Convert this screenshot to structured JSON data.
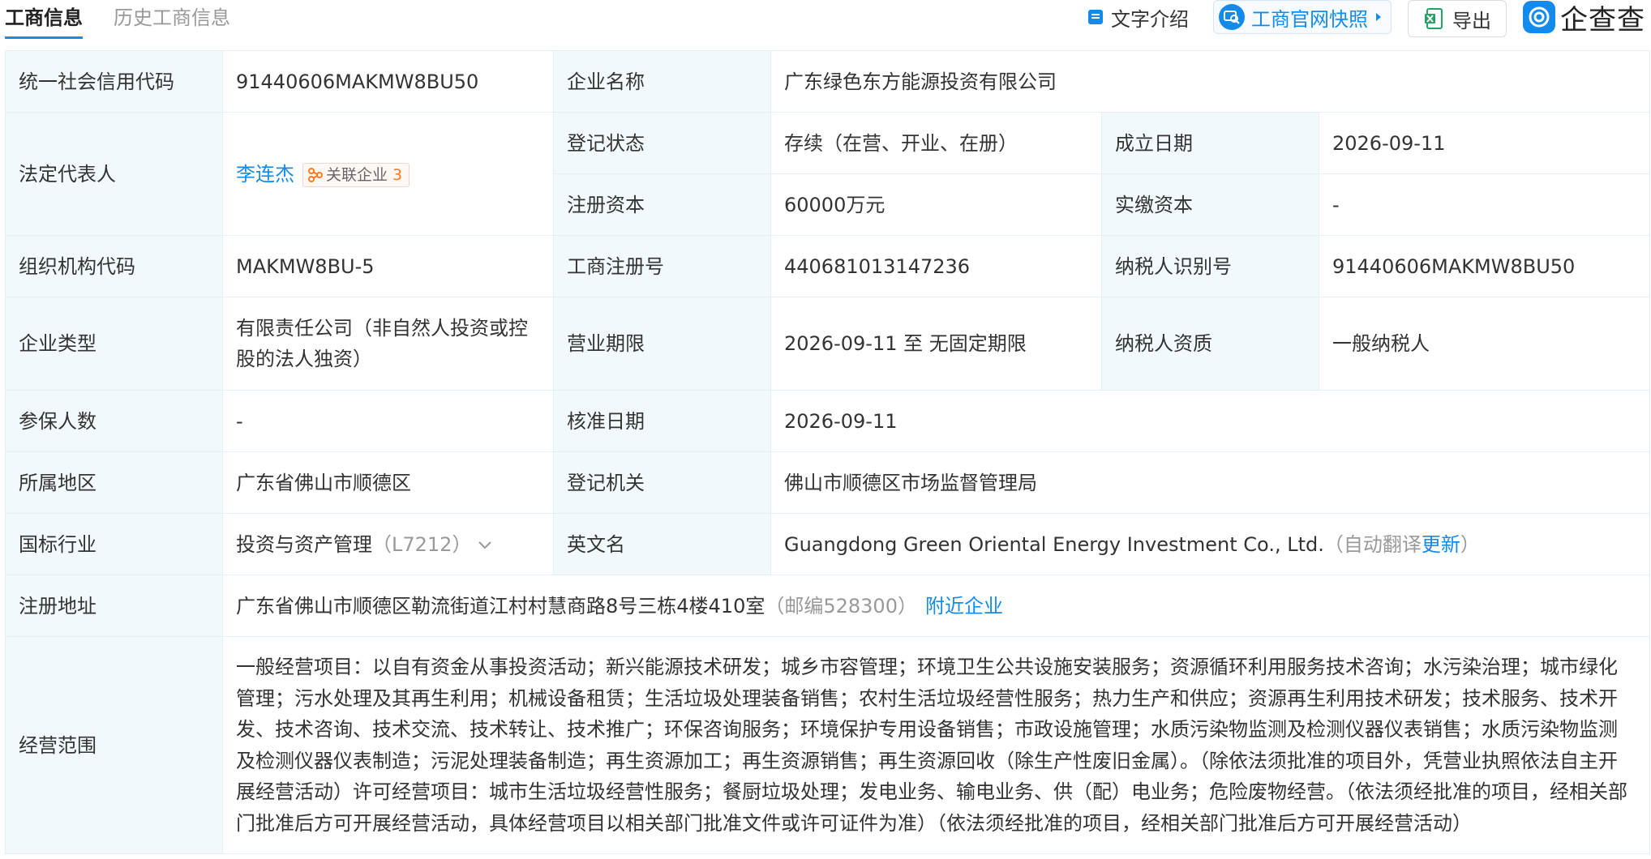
{
  "tabs": {
    "current": "工商信息",
    "history": "历史工商信息"
  },
  "toolbar": {
    "intro_label": "文字介绍",
    "snapshot_label": "工商官网快照",
    "export_label": "导出",
    "logo_text": "企查查"
  },
  "colors": {
    "accent": "#128bed",
    "label_bg": "#f2f9fc",
    "border": "#e4eef6",
    "tag_count": "#fd7b1f"
  },
  "fields": {
    "credit_code": {
      "label": "统一社会信用代码",
      "value": "91440606MAKMW8BU50"
    },
    "company_name": {
      "label": "企业名称",
      "value": "广东绿色东方能源投资有限公司"
    },
    "legal_rep": {
      "label": "法定代表人",
      "name": "李连杰",
      "related_label": "关联企业",
      "related_count": "3"
    },
    "reg_status": {
      "label": "登记状态",
      "value": "存续（在营、开业、在册）"
    },
    "est_date": {
      "label": "成立日期",
      "value": "2026-09-11"
    },
    "reg_capital": {
      "label": "注册资本",
      "value": "60000万元"
    },
    "paid_capital": {
      "label": "实缴资本",
      "value": "-"
    },
    "org_code": {
      "label": "组织机构代码",
      "value": "MAKMW8BU-5"
    },
    "reg_number": {
      "label": "工商注册号",
      "value": "440681013147236"
    },
    "taxpayer_id": {
      "label": "纳税人识别号",
      "value": "91440606MAKMW8BU50"
    },
    "company_type": {
      "label": "企业类型",
      "value": "有限责任公司（非自然人投资或控股的法人独资）"
    },
    "business_term": {
      "label": "营业期限",
      "value": "2026-09-11 至 无固定期限"
    },
    "taxpayer_qual": {
      "label": "纳税人资质",
      "value": "一般纳税人"
    },
    "insured": {
      "label": "参保人数",
      "value": "-"
    },
    "approval_date": {
      "label": "核准日期",
      "value": "2026-09-11"
    },
    "region": {
      "label": "所属地区",
      "value": "广东省佛山市顺德区"
    },
    "authority": {
      "label": "登记机关",
      "value": "佛山市顺德区市场监督管理局"
    },
    "industry": {
      "label": "国标行业",
      "value": "投资与资产管理",
      "code": "（L7212）"
    },
    "english_name": {
      "label": "英文名",
      "value": "Guangdong Green Oriental Energy Investment Co., Ltd.",
      "note_open": "（自动翻译",
      "update_link": "更新",
      "note_close": "）"
    },
    "address": {
      "label": "注册地址",
      "value": "广东省佛山市顺德区勒流街道江村村慧商路8号三栋4楼410室",
      "postcode": "（邮编528300）",
      "nearby_link": "附近企业"
    },
    "scope": {
      "label": "经营范围",
      "value": "一般经营项目：以自有资金从事投资活动；新兴能源技术研发；城乡市容管理；环境卫生公共设施安装服务；资源循环利用服务技术咨询；水污染治理；城市绿化管理；污水处理及其再生利用；机械设备租赁；生活垃圾处理装备销售；农村生活垃圾经营性服务；热力生产和供应；资源再生利用技术研发；技术服务、技术开发、技术咨询、技术交流、技术转让、技术推广；环保咨询服务；环境保护专用设备销售；市政设施管理；水质污染物监测及检测仪器仪表销售；水质污染物监测及检测仪器仪表制造；污泥处理装备制造；再生资源加工；再生资源销售；再生资源回收（除生产性废旧金属）。（除依法须批准的项目外，凭营业执照依法自主开展经营活动）许可经营项目：城市生活垃圾经营性服务；餐厨垃圾处理；发电业务、输电业务、供（配）电业务；危险废物经营。（依法须经批准的项目，经相关部门批准后方可开展经营活动，具体经营项目以相关部门批准文件或许可证件为准）（依法须经批准的项目，经相关部门批准后方可开展经营活动）"
    }
  }
}
